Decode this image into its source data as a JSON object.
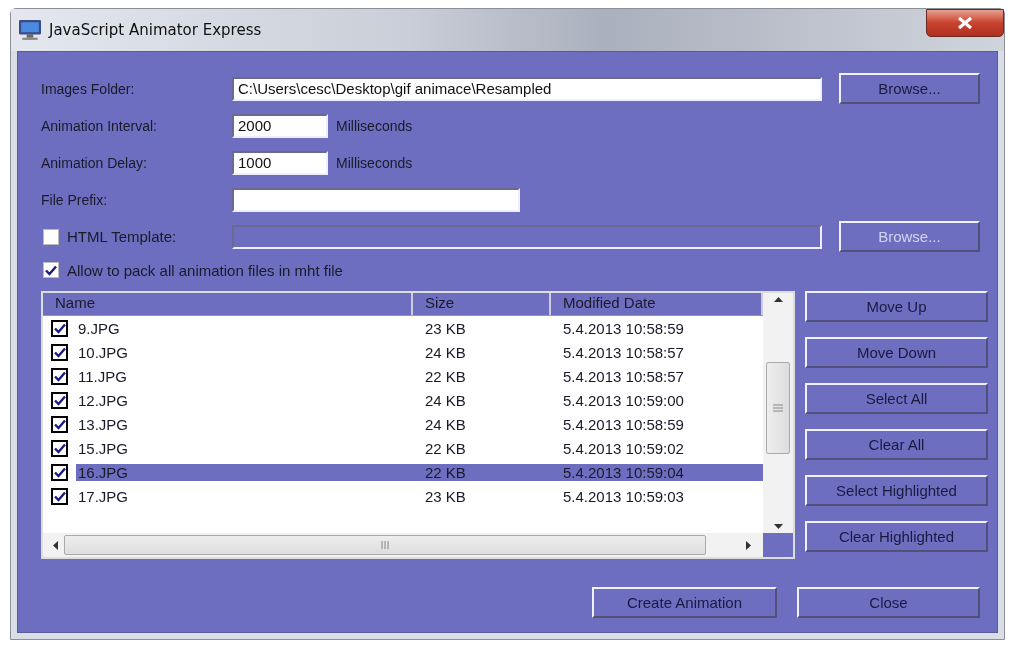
{
  "window": {
    "title": "JavaScript Animator Express"
  },
  "images_folder": {
    "label": "Images Folder:",
    "value": "C:\\Users\\cesc\\Desktop\\gif animace\\Resampled",
    "button": {
      "label": "Browse...",
      "disabled": false
    }
  },
  "interval": {
    "label": "Animation Interval:",
    "value": "2000",
    "unit": "Milliseconds"
  },
  "delay": {
    "label": "Animation Delay:",
    "value": "1000",
    "unit": "Milliseconds"
  },
  "file_prefix": {
    "label": "File Prefix:"
  },
  "html_template": {
    "label": "HTML Template:",
    "checked": false,
    "disabled": true,
    "button": {
      "label": "Browse...",
      "disabled": true
    }
  },
  "pack_option": {
    "label": "Allow to pack all animation files in mht file",
    "checked": true
  },
  "file_list": {
    "columns": [
      "Name",
      "Size",
      "Modified Date"
    ],
    "rows": [
      {
        "name": "9.JPG",
        "size": "23 KB",
        "modified": "5.4.2013 10:58:59",
        "checked": true,
        "selected": false
      },
      {
        "name": "10.JPG",
        "size": "24 KB",
        "modified": "5.4.2013 10:58:57",
        "checked": true,
        "selected": false
      },
      {
        "name": "11.JPG",
        "size": "22 KB",
        "modified": "5.4.2013 10:58:57",
        "checked": true,
        "selected": false
      },
      {
        "name": "12.JPG",
        "size": "24 KB",
        "modified": "5.4.2013 10:59:00",
        "checked": true,
        "selected": false
      },
      {
        "name": "13.JPG",
        "size": "24 KB",
        "modified": "5.4.2013 10:58:59",
        "checked": true,
        "selected": false
      },
      {
        "name": "15.JPG",
        "size": "22 KB",
        "modified": "5.4.2013 10:59:02",
        "checked": true,
        "selected": false
      },
      {
        "name": "16.JPG",
        "size": "22 KB",
        "modified": "5.4.2013 10:59:04",
        "checked": true,
        "selected": true
      },
      {
        "name": "17.JPG",
        "size": "23 KB",
        "modified": "5.4.2013 10:59:03",
        "checked": true,
        "selected": false
      }
    ]
  },
  "side_buttons": [
    "Move Up",
    "Move Down",
    "Select All",
    "Clear All",
    "Select Highlighted",
    "Clear Highlighted"
  ],
  "bottom_buttons": [
    "Create Animation",
    "Close"
  ]
}
